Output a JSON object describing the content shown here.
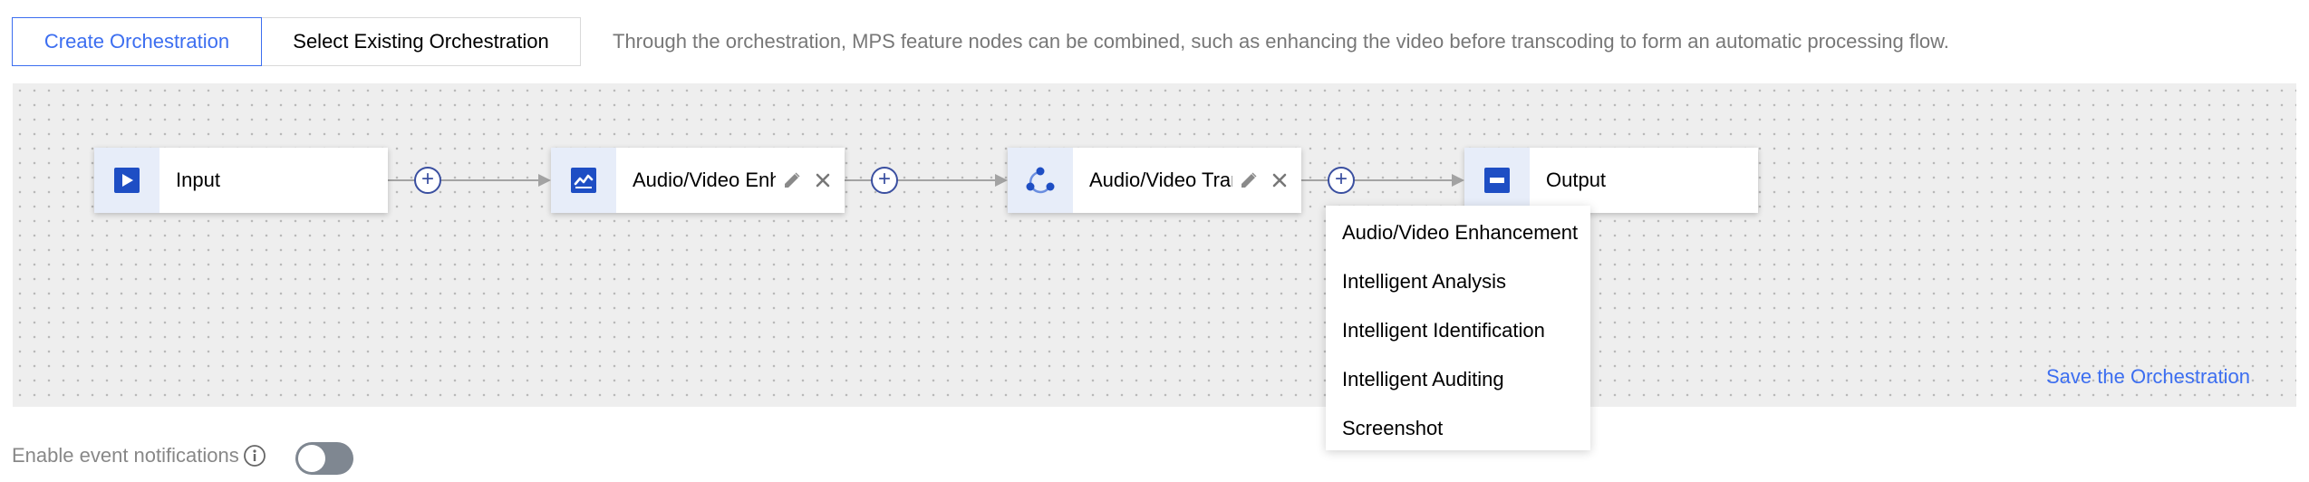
{
  "tabs": {
    "create_label": "Create Orchestration",
    "select_label": "Select Existing Orchestration"
  },
  "description": "Through the orchestration, MPS feature nodes can be combined, such as enhancing the video before transcoding to form an automatic processing flow.",
  "flow": {
    "nodes": [
      {
        "label": "Input",
        "icon": "play-icon"
      },
      {
        "label": "Audio/Video Enh",
        "icon": "enhance-icon"
      },
      {
        "label": "Audio/Video Tran",
        "icon": "transcode-icon"
      },
      {
        "label": "Output",
        "icon": "output-icon"
      }
    ],
    "add_symbol": "+"
  },
  "save_label": "Save the Orchestration",
  "add_menu": {
    "items": [
      "Audio/Video Enhancement",
      "Intelligent Analysis",
      "Intelligent Identification",
      "Intelligent Auditing",
      "Screenshot"
    ]
  },
  "notifications": {
    "label": "Enable event notifications",
    "enabled": false
  },
  "colors": {
    "accent": "#3c6ef0",
    "icon_blue": "#1e4ec4",
    "plus_border": "#3a4fa0",
    "toggle_off": "#7f8791"
  }
}
